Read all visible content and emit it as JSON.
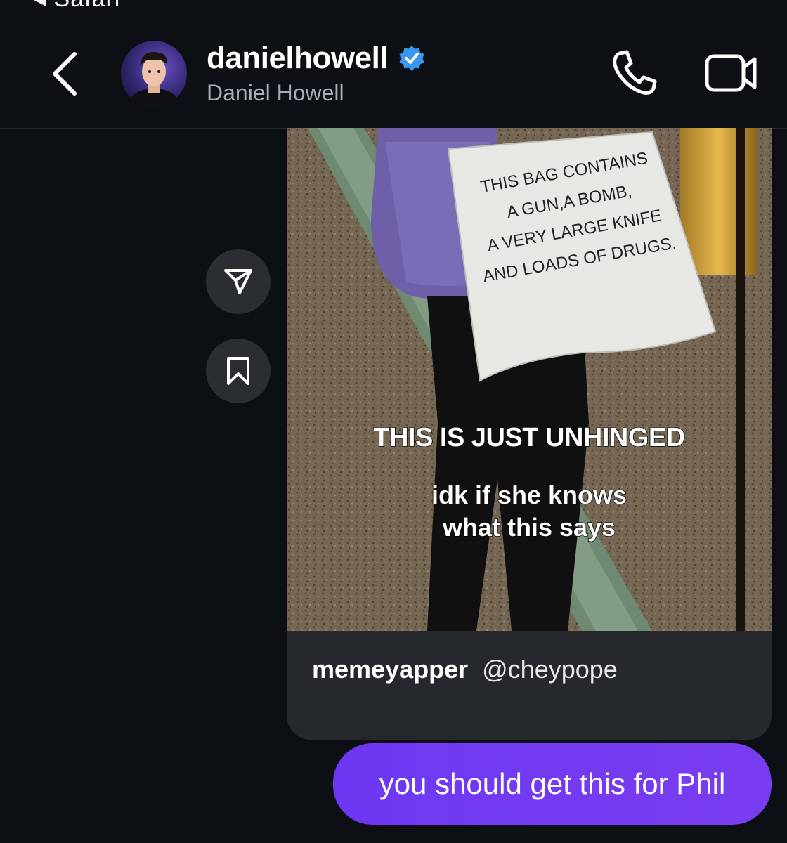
{
  "status_bar": {
    "back_app_label": "Safari"
  },
  "header": {
    "username": "danielhowell",
    "full_name": "Daniel Howell",
    "verified": true,
    "accent_color": "#3897f0"
  },
  "side_actions": {
    "share_icon": "send-icon",
    "save_icon": "bookmark-icon"
  },
  "shared_post": {
    "bag_text": [
      "THIS BAG CONTAINS",
      "A GUN,A BOMB,",
      "A VERY LARGE KNIFE",
      "AND LOADS OF DRUGS."
    ],
    "overlay_caption": "THIS IS JUST UNHINGED",
    "overlay_subcaption_line1": "idk if she knows",
    "overlay_subcaption_line2": "what this says",
    "author": "memeyapper",
    "handle": "@cheypope"
  },
  "message": {
    "text": "you should get this for Phil",
    "bubble_color": "#7a3cf0"
  }
}
